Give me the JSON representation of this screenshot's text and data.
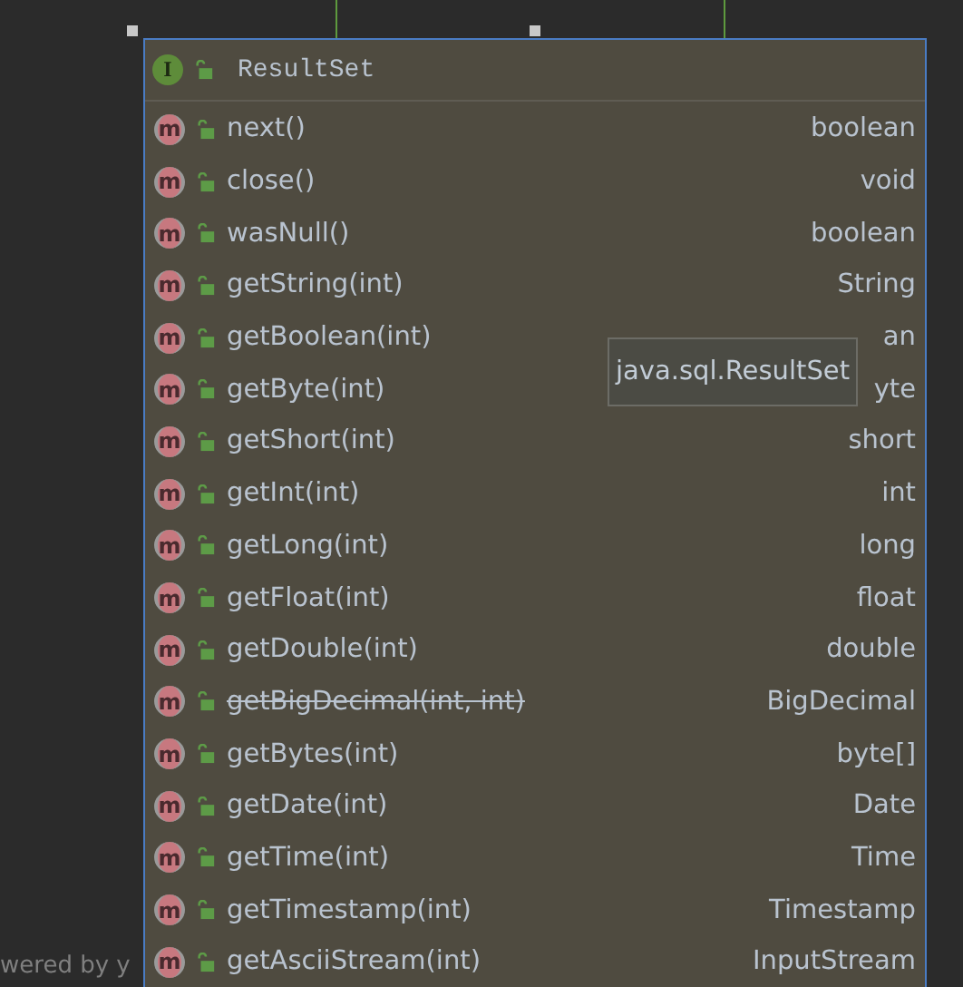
{
  "popup": {
    "header": {
      "icon": "I",
      "title": "ResultSet"
    },
    "rows": [
      {
        "icon": "m",
        "name": "next()",
        "type": "boolean",
        "deprecated": false
      },
      {
        "icon": "m",
        "name": "close()",
        "type": "void",
        "deprecated": false
      },
      {
        "icon": "m",
        "name": "wasNull()",
        "type": "boolean",
        "deprecated": false
      },
      {
        "icon": "m",
        "name": "getString(int)",
        "type": "String",
        "deprecated": false
      },
      {
        "icon": "m",
        "name": "getBoolean(int)",
        "type": "an",
        "deprecated": false
      },
      {
        "icon": "m",
        "name": "getByte(int)",
        "type": "yte",
        "deprecated": false
      },
      {
        "icon": "m",
        "name": "getShort(int)",
        "type": "short",
        "deprecated": false
      },
      {
        "icon": "m",
        "name": "getInt(int)",
        "type": "int",
        "deprecated": false
      },
      {
        "icon": "m",
        "name": "getLong(int)",
        "type": "long",
        "deprecated": false
      },
      {
        "icon": "m",
        "name": "getFloat(int)",
        "type": "float",
        "deprecated": false
      },
      {
        "icon": "m",
        "name": "getDouble(int)",
        "type": "double",
        "deprecated": false
      },
      {
        "icon": "m",
        "name": "getBigDecimal(int, int)",
        "type": "BigDecimal",
        "deprecated": true
      },
      {
        "icon": "m",
        "name": "getBytes(int)",
        "type": "byte[]",
        "deprecated": false
      },
      {
        "icon": "m",
        "name": "getDate(int)",
        "type": "Date",
        "deprecated": false
      },
      {
        "icon": "m",
        "name": "getTime(int)",
        "type": "Time",
        "deprecated": false
      },
      {
        "icon": "m",
        "name": "getTimestamp(int)",
        "type": "Timestamp",
        "deprecated": false
      },
      {
        "icon": "m",
        "name": "getAsciiStream(int)",
        "type": "InputStream",
        "deprecated": false
      }
    ],
    "tooltip": "java.sql.ResultSet"
  },
  "footer_text": "wered by y"
}
